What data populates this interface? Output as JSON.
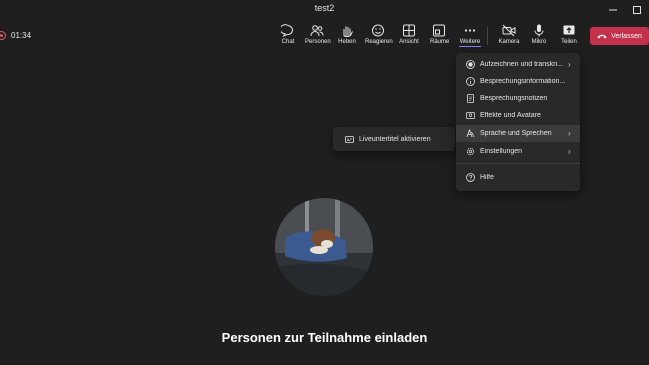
{
  "window": {
    "title": "test2"
  },
  "call": {
    "timer": "01:34"
  },
  "toolbar": {
    "chat": "Chat",
    "people": "Personen",
    "raise": "Heben",
    "react": "Reagieren",
    "view": "Ansicht",
    "rooms": "Räume",
    "more": "Weitere",
    "camera": "Kamera",
    "mic": "Mikro",
    "share": "Teilen",
    "leave": "Verlassen"
  },
  "more_menu": {
    "items": [
      {
        "label": "Aufzeichnen und transkri...",
        "icon": "record-icon",
        "has_submenu": true
      },
      {
        "label": "Besprechungsinformation...",
        "icon": "info-icon",
        "has_submenu": false
      },
      {
        "label": "Besprechungsnotizen",
        "icon": "notes-icon",
        "has_submenu": false
      },
      {
        "label": "Effekte und Avatare",
        "icon": "effects-icon",
        "has_submenu": false
      },
      {
        "label": "Sprache und Sprechen",
        "icon": "language-icon",
        "has_submenu": true
      },
      {
        "label": "Einstellungen",
        "icon": "gear-icon",
        "has_submenu": true
      },
      {
        "label": "Hilfe",
        "icon": "help-icon",
        "has_submenu": false
      }
    ]
  },
  "submenu": {
    "captions": "Liveuntertitel aktivieren"
  },
  "stage": {
    "invite": "Personen zur Teilnahme einladen"
  },
  "colors": {
    "accent": "#7f85f5",
    "leave": "#c4314b",
    "background": "#1f1f1f",
    "menu": "#292929"
  }
}
